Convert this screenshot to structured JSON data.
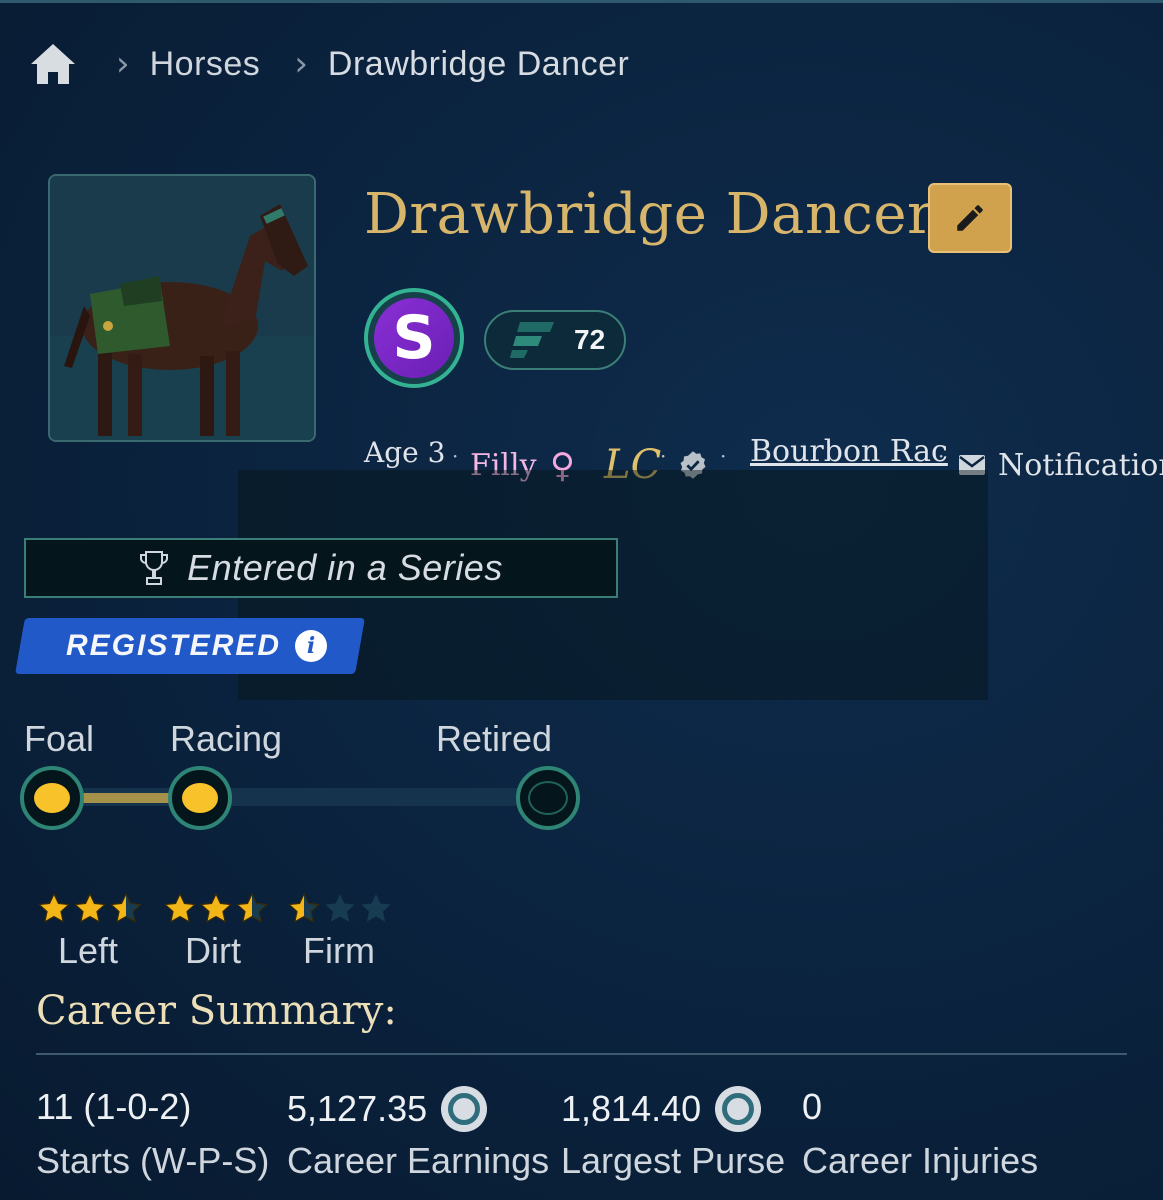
{
  "breadcrumb": {
    "home_icon": "home-icon",
    "items": [
      "Horses",
      "Drawbridge Dancer"
    ]
  },
  "horse": {
    "name": "Drawbridge Dancer",
    "class_badge": "S",
    "rating": "72",
    "age": "Age 3",
    "sex": "Filly",
    "sex_symbol": "♀",
    "stable_initials": "LC",
    "stable_name": "Bourbon Rac",
    "notifications_label": "Notification"
  },
  "series": {
    "label": "Entered in a Series"
  },
  "registration": {
    "label": "REGISTERED",
    "info_glyph": "i"
  },
  "lifecycle": {
    "stages": [
      "Foal",
      "Racing",
      "Retired"
    ],
    "active_stage_index": 1
  },
  "preferences": [
    {
      "label": "Left",
      "stars": 2.5,
      "max": 3
    },
    {
      "label": "Dirt",
      "stars": 2.5,
      "max": 3
    },
    {
      "label": "Firm",
      "stars": 0.5,
      "max": 3
    }
  ],
  "career": {
    "title": "Career Summary:",
    "stats": [
      {
        "value": "11 (1-0-2)",
        "label": "Starts (W-P-S)",
        "coin": false
      },
      {
        "value": "5,127.35",
        "label": "Career Earnings",
        "coin": true
      },
      {
        "value": "1,814.40",
        "label": "Largest Purse",
        "coin": true
      },
      {
        "value": "0",
        "label": "Career Injuries",
        "coin": false
      }
    ]
  },
  "colors": {
    "background": "#0b2440",
    "gold_title": "#d7b56a",
    "edit_button": "#d0a24e",
    "badge_purple": "#7a28c6",
    "accent_teal": "#2e8576",
    "registered_blue": "#2159c9",
    "star_gold": "#f2b619",
    "filly_pink": "#f5b8e4"
  }
}
